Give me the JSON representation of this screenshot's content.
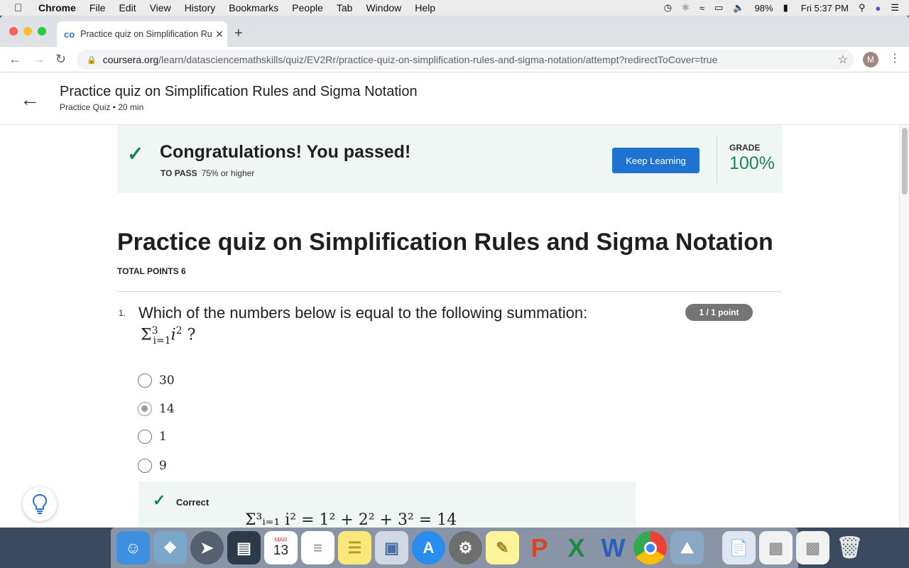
{
  "menubar": {
    "items": [
      "Chrome",
      "File",
      "Edit",
      "View",
      "History",
      "Bookmarks",
      "People",
      "Tab",
      "Window",
      "Help"
    ],
    "battery": "98%",
    "clock": "Fri 5:37 PM"
  },
  "browser": {
    "tab_title": "Practice quiz on Simplification Rules and Sigma Notation",
    "url_host": "coursera.org",
    "url_path": "/learn/datasciencemathskills/quiz/EV2Rr/practice-quiz-on-simplification-rules-and-sigma-notation/attempt?redirectToCover=true",
    "avatar_letter": "M"
  },
  "header": {
    "title": "Practice quiz on Simplification Rules and Sigma Notation",
    "subtitle": "Practice Quiz • 20 min"
  },
  "banner": {
    "message": "Congratulations! You passed!",
    "to_pass_label": "TO PASS",
    "to_pass_value": "75% or higher",
    "button": "Keep Learning",
    "grade_label": "GRADE",
    "grade_value": "100%"
  },
  "quiz": {
    "title": "Practice quiz on Simplification Rules and Sigma Notation",
    "total_points": "TOTAL POINTS 6"
  },
  "question1": {
    "number": "1.",
    "text": "Which of the numbers below is equal to the following summation:",
    "math_upper": "3",
    "math_lower": "i=1",
    "math_var": "i",
    "math_exp": "2",
    "math_tail": " ?",
    "points": "1 / 1 point",
    "options": [
      "30",
      "14",
      "1",
      "9"
    ],
    "selected_index": 1,
    "feedback_label": "Correct",
    "feedback_formula": "Σ³ᵢ₌₁ i² = 1² + 2² + 3² = 14"
  },
  "dock": {
    "calendar_month": "MAR",
    "calendar_day": "13"
  },
  "colors": {
    "success": "#1f8354",
    "primary": "#1f73d0",
    "banner_bg": "#eff6f4"
  }
}
